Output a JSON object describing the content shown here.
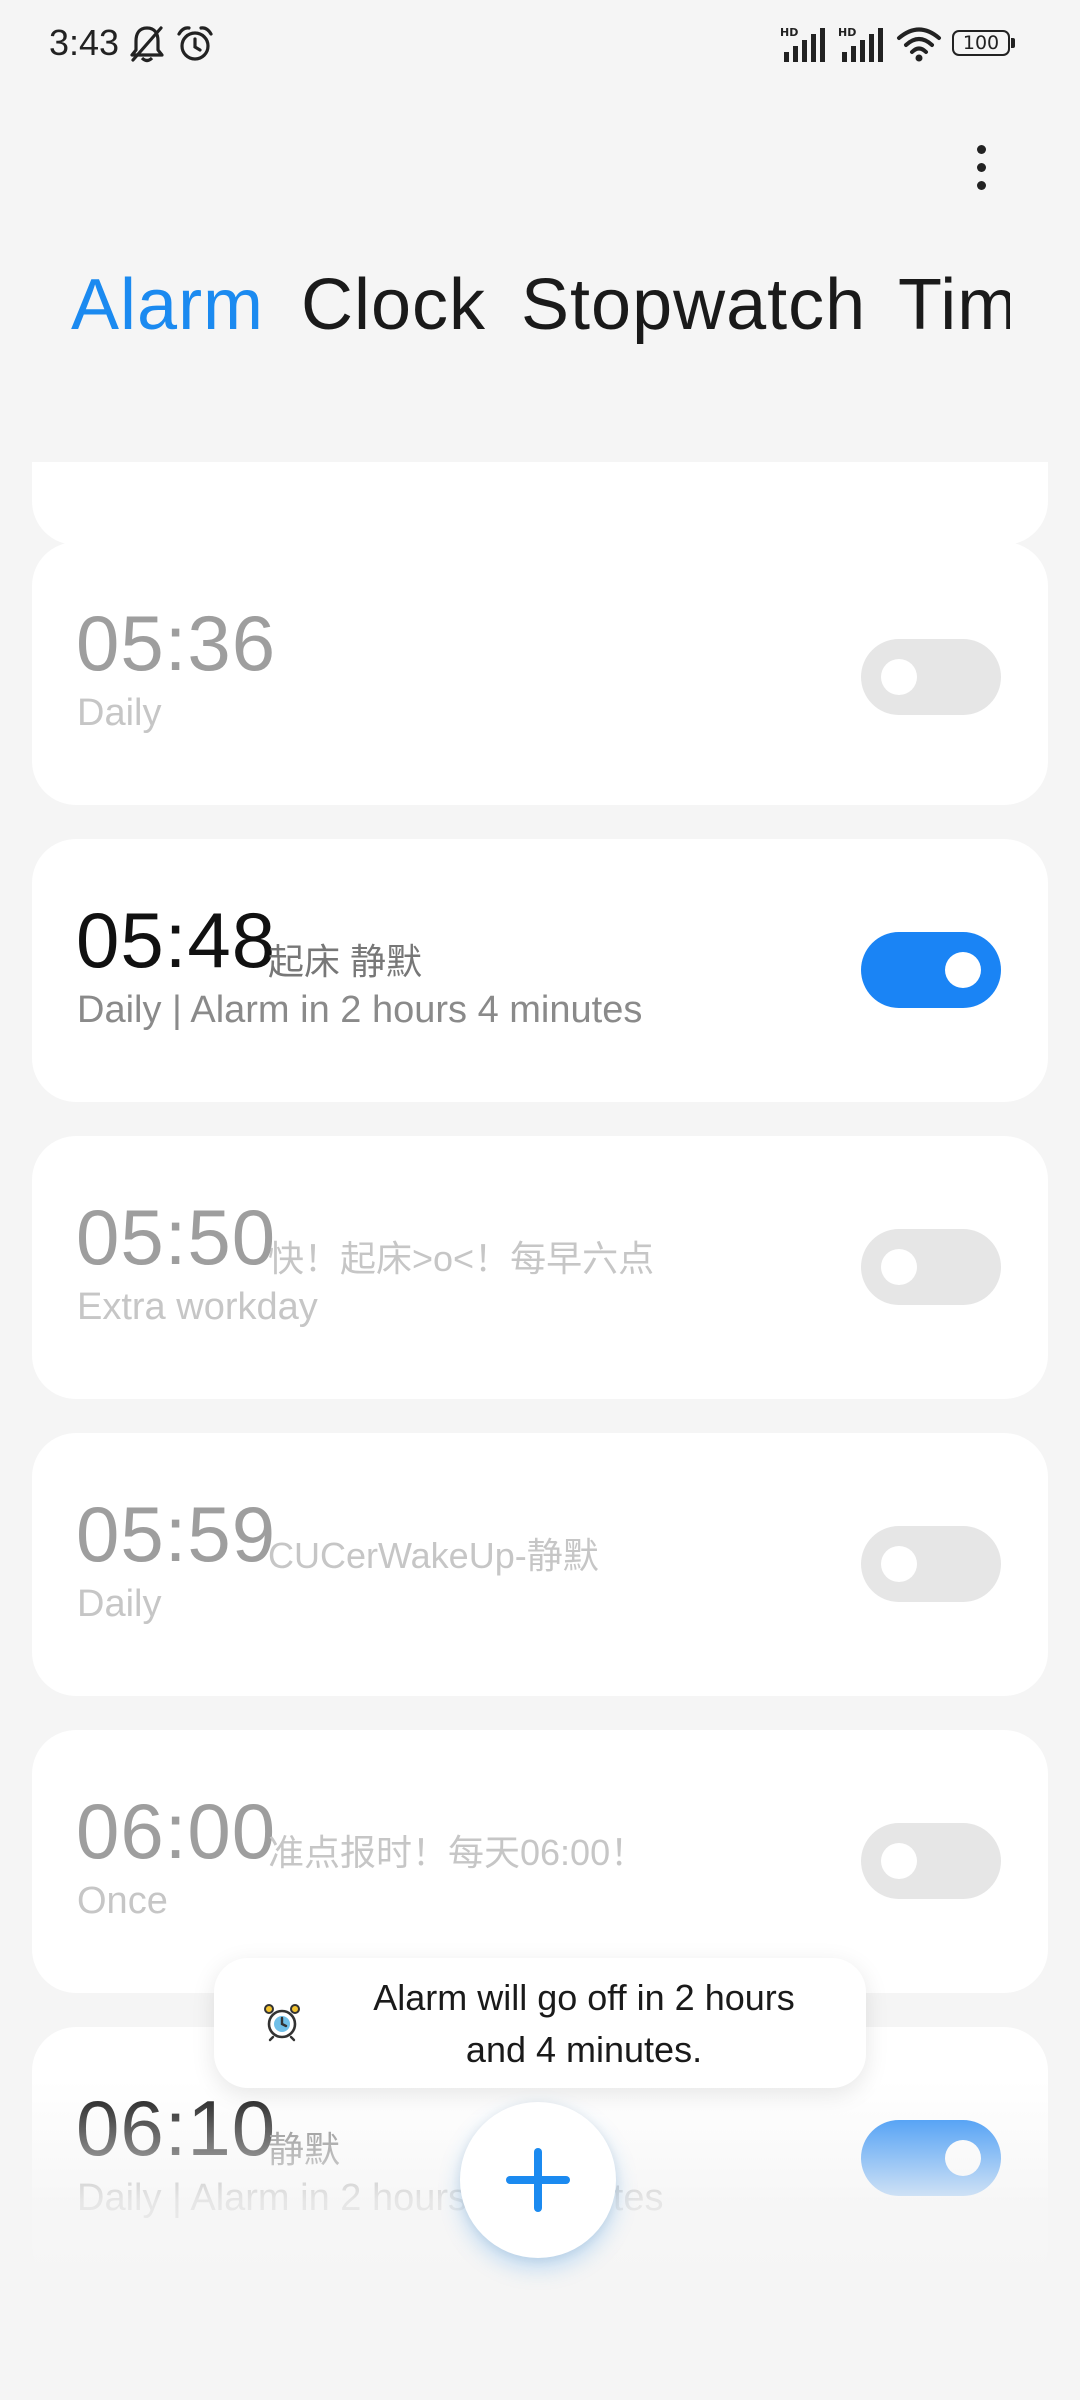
{
  "status_bar": {
    "time": "3:43",
    "battery": "100"
  },
  "tabs": [
    {
      "label": "Alarm",
      "active": true
    },
    {
      "label": "Clock",
      "active": false
    },
    {
      "label": "Stopwatch",
      "active": false
    },
    {
      "label": "Tim",
      "active": false
    }
  ],
  "alarms": [
    {
      "time": "05:36",
      "label": "",
      "repeat": "Daily",
      "enabled": false
    },
    {
      "time": "05:48",
      "label": "起床 静默",
      "repeat": "Daily | Alarm in 2 hours 4 minutes",
      "enabled": true
    },
    {
      "time": "05:50",
      "label": "快！起床>o<！每早六点",
      "repeat": "Extra workday",
      "enabled": false
    },
    {
      "time": "05:59",
      "label": "CUCerWakeUp-静默",
      "repeat": "Daily",
      "enabled": false
    },
    {
      "time": "06:00",
      "label": "准点报时！每天06:00！",
      "repeat": "Once",
      "enabled": false
    },
    {
      "time": "06:10",
      "label": "静默",
      "repeat": "Daily | Alarm in 2 hours 14 minutes",
      "enabled": true
    }
  ],
  "toast": {
    "line1": "Alarm will go off in 2 hours",
    "line2": "and 4 minutes."
  },
  "colors": {
    "accent": "#1b8af0",
    "toggle_on": "#1a84f5",
    "toggle_off": "#e6e6e6",
    "background": "#f5f5f5"
  },
  "icons": {
    "status_left": [
      "bell-off-icon",
      "alarm-clock-icon"
    ],
    "status_right": [
      "signal-hd-icon",
      "signal-hd-icon",
      "wifi-icon",
      "battery-icon"
    ],
    "fab": "plus-icon",
    "toast": "alarm-clock-icon",
    "menu": "more-vertical-icon"
  }
}
